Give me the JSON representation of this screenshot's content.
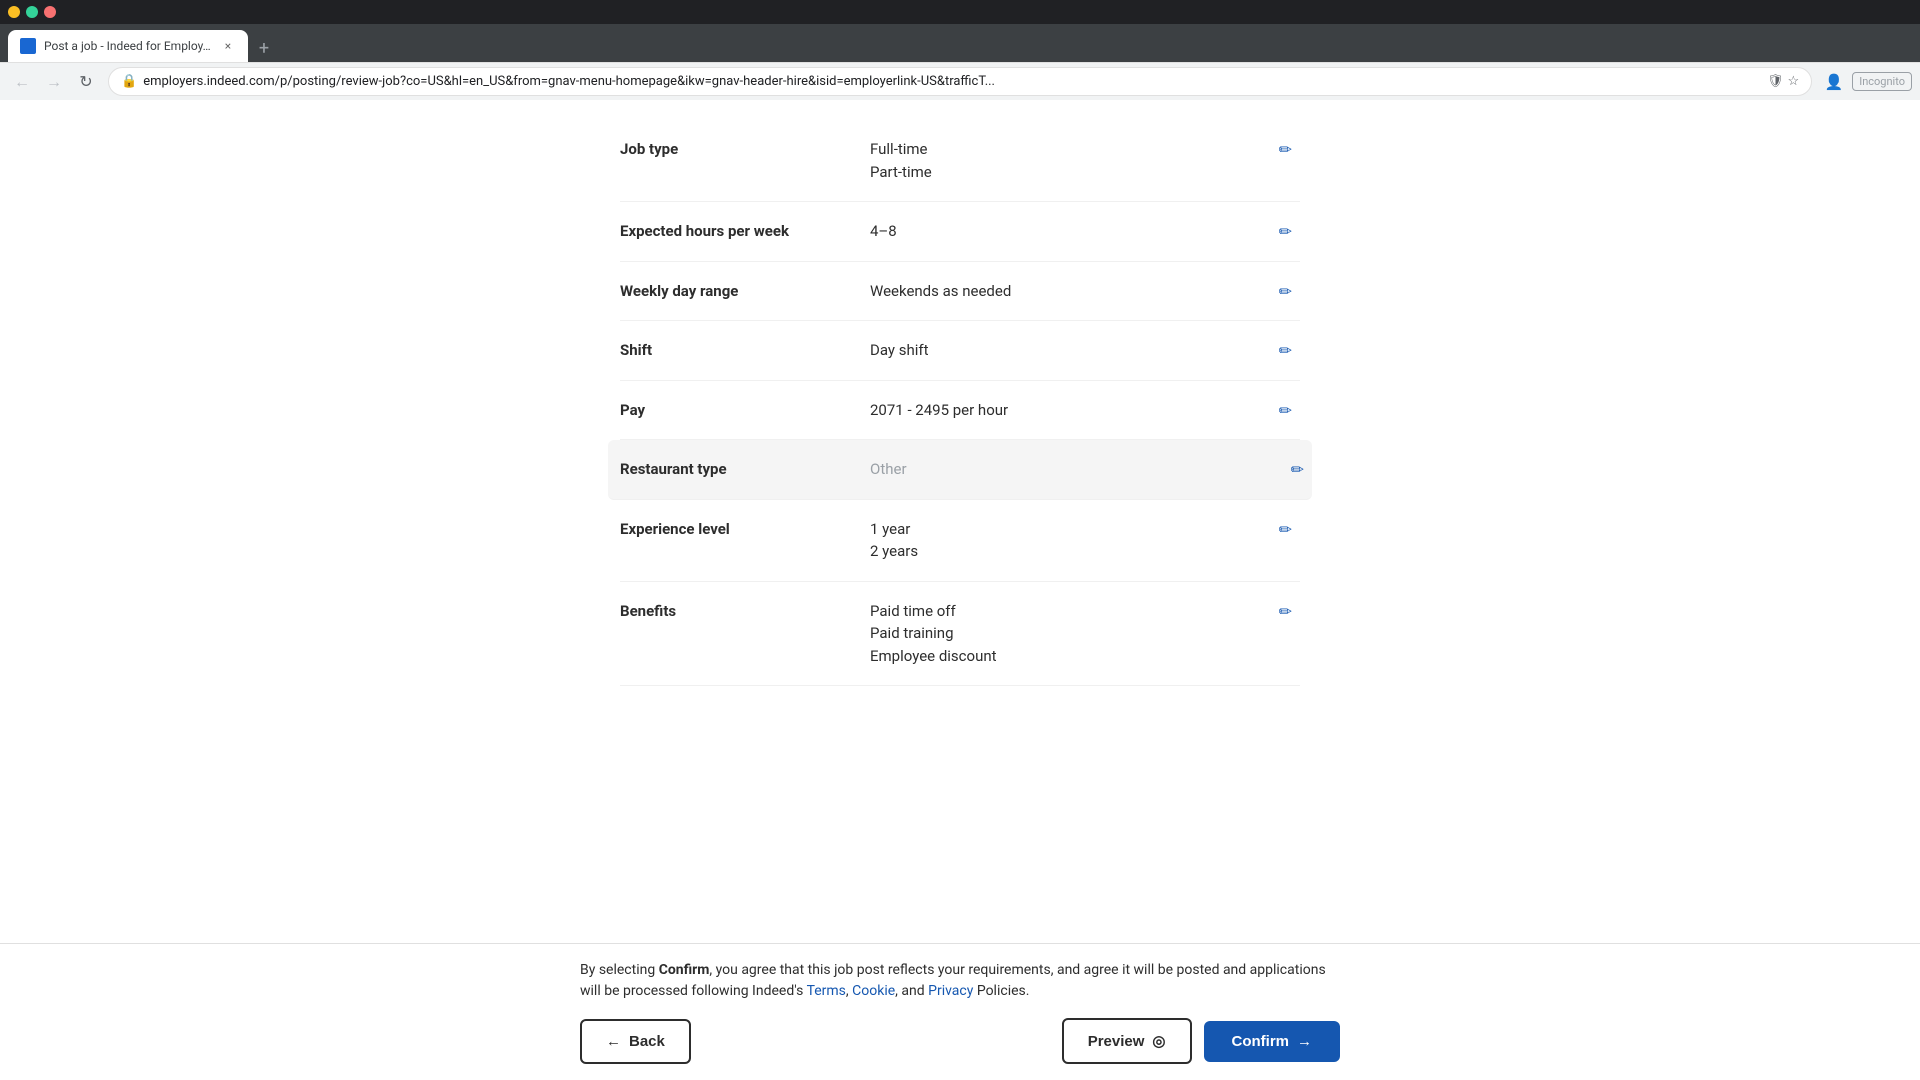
{
  "browser": {
    "tab_title": "Post a job - Indeed for Employ...",
    "tab_close_label": "×",
    "new_tab_label": "+",
    "address_url": "employers.indeed.com/p/posting/review-job?co=US&hl=en_US&from=gnav-menu-homepage&ikw=gnav-header-hire&isid=employerlink-US&trafficT...",
    "incognito_label": "Incognito"
  },
  "form": {
    "fields": [
      {
        "id": "job-type",
        "label": "Job type",
        "values": [
          "Full-time",
          "Part-time"
        ],
        "highlighted": false
      },
      {
        "id": "expected-hours",
        "label": "Expected hours per week",
        "values": [
          "4–8"
        ],
        "highlighted": false
      },
      {
        "id": "weekly-day-range",
        "label": "Weekly day range",
        "values": [
          "Weekends as needed"
        ],
        "highlighted": false
      },
      {
        "id": "shift",
        "label": "Shift",
        "values": [
          "Day shift"
        ],
        "highlighted": false
      },
      {
        "id": "pay",
        "label": "Pay",
        "values": [
          "2071 - 2495 per hour"
        ],
        "highlighted": false
      },
      {
        "id": "restaurant-type",
        "label": "Restaurant type",
        "values": [
          "Other"
        ],
        "highlighted": true
      },
      {
        "id": "experience-level",
        "label": "Experience level",
        "values": [
          "1 year",
          "2 years"
        ],
        "highlighted": false
      },
      {
        "id": "benefits",
        "label": "Benefits",
        "values": [
          "Paid time off",
          "Paid training",
          "Employee discount"
        ],
        "highlighted": false,
        "truncated": true
      }
    ]
  },
  "bottom_bar": {
    "confirm_text_prefix": "By selecting ",
    "confirm_bold": "Confirm",
    "confirm_text_mid": ", you agree that this job post reflects your requirements, and agree it will be posted and applications will be processed following Indeed's ",
    "terms_label": "Terms",
    "comma": ",",
    "cookie_label": "Cookie",
    "and_label": ", and ",
    "privacy_label": "Privacy",
    "policies_label": " Policies.",
    "back_label": "Back",
    "preview_label": "Preview",
    "confirm_label": "Confirm"
  }
}
